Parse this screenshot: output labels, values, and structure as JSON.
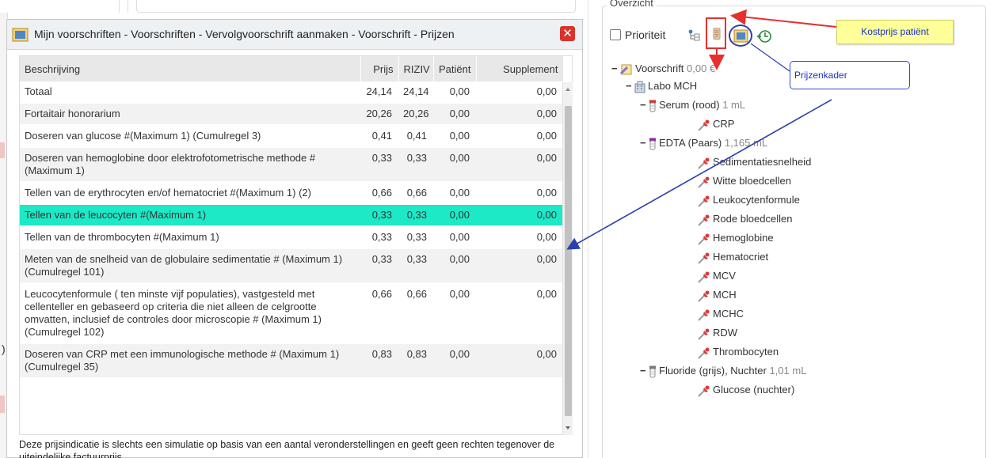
{
  "panel": {
    "title": "Overzicht",
    "priority_label": "Prioriteit"
  },
  "annotations": {
    "kostprijs": "Kostprijs patiënt",
    "prijzenkader": "Prijzenkader"
  },
  "dialog": {
    "title": "Mijn voorschriften - Voorschriften - Vervolgvoorschrift aanmaken - Voorschrift - Prijzen",
    "close": "✕",
    "columns": [
      "Beschrijving",
      "Prijs",
      "RIZIV",
      "Patiënt",
      "Supplement"
    ],
    "rows": [
      {
        "desc": "Totaal",
        "prijs": "24,14",
        "riziv": "24,14",
        "patient": "0,00",
        "supplement": "0,00"
      },
      {
        "desc": "Fortaitair honorarium",
        "prijs": "20,26",
        "riziv": "20,26",
        "patient": "0,00",
        "supplement": "0,00"
      },
      {
        "desc": "Doseren van glucose #(Maximum 1) (Cumulregel 3)",
        "prijs": "0,41",
        "riziv": "0,41",
        "patient": "0,00",
        "supplement": "0,00"
      },
      {
        "desc": "Doseren van hemoglobine door elektrofotometrische methode #(Maximum 1)",
        "prijs": "0,33",
        "riziv": "0,33",
        "patient": "0,00",
        "supplement": "0,00"
      },
      {
        "desc": "Tellen van de erythrocyten en/of hematocriet #(Maximum 1) (2)",
        "prijs": "0,66",
        "riziv": "0,66",
        "patient": "0,00",
        "supplement": "0,00"
      },
      {
        "desc": "Tellen van de leucocyten #(Maximum 1)",
        "prijs": "0,33",
        "riziv": "0,33",
        "patient": "0,00",
        "supplement": "0,00",
        "selected": true
      },
      {
        "desc": "Tellen van de thrombocyten #(Maximum 1)",
        "prijs": "0,33",
        "riziv": "0,33",
        "patient": "0,00",
        "supplement": "0,00"
      },
      {
        "desc": "Meten van de snelheid van de globulaire sedimentatie # (Maximum 1) (Cumulregel 101)",
        "prijs": "0,33",
        "riziv": "0,33",
        "patient": "0,00",
        "supplement": "0,00"
      },
      {
        "desc": "Leucocytenformule ( ten minste vijf populaties), vastgesteld met cellenteller en gebaseerd op criteria die niet alleen de celgrootte omvatten, inclusief de controles door microscopie # (Maximum 1) (Cumulregel 102)",
        "prijs": "0,66",
        "riziv": "0,66",
        "patient": "0,00",
        "supplement": "0,00"
      },
      {
        "desc": "Doseren van CRP met een immunologische methode # (Maximum 1) (Cumulregel 35)",
        "prijs": "0,83",
        "riziv": "0,83",
        "patient": "0,00",
        "supplement": "0,00"
      }
    ],
    "footnote": "Deze prijsindicatie is slechts een simulatie op basis van een aantal veronderstellingen en geeft geen rechten tegenover de uiteindelijke factuurprijs."
  },
  "tree": {
    "root": {
      "label": "Voorschrift",
      "amount": "0,00 €"
    },
    "lab": "Labo MCH",
    "tubes": [
      {
        "label": "Serum (rood)",
        "volume": "1 mL",
        "tests": [
          "CRP"
        ]
      },
      {
        "label": "EDTA (Paars)",
        "volume": "1,165 mL",
        "tests": [
          "Sedimentatiesnelheid",
          "Witte bloedcellen",
          "Leukocytenformule",
          "Rode bloedcellen",
          "Hemoglobine",
          "Hematocriet",
          "MCV",
          "MCH",
          "MCHC",
          "RDW",
          "Thrombocyten"
        ]
      },
      {
        "label": "Fluoride (grijs), Nuchter",
        "volume": "1,01 mL",
        "tests": [
          "Glucose (nuchter)"
        ]
      }
    ],
    "collapse_glyph": "−"
  },
  "colors": {
    "selected_row": "#1de9c6",
    "arrow_red": "#e53030",
    "arrow_blue": "#2a3fb0",
    "note_yellow": "#ffff99",
    "tube_red": "#d0343a",
    "tube_purple": "#8e2a9c",
    "tube_grey": "#7a7a7a"
  }
}
